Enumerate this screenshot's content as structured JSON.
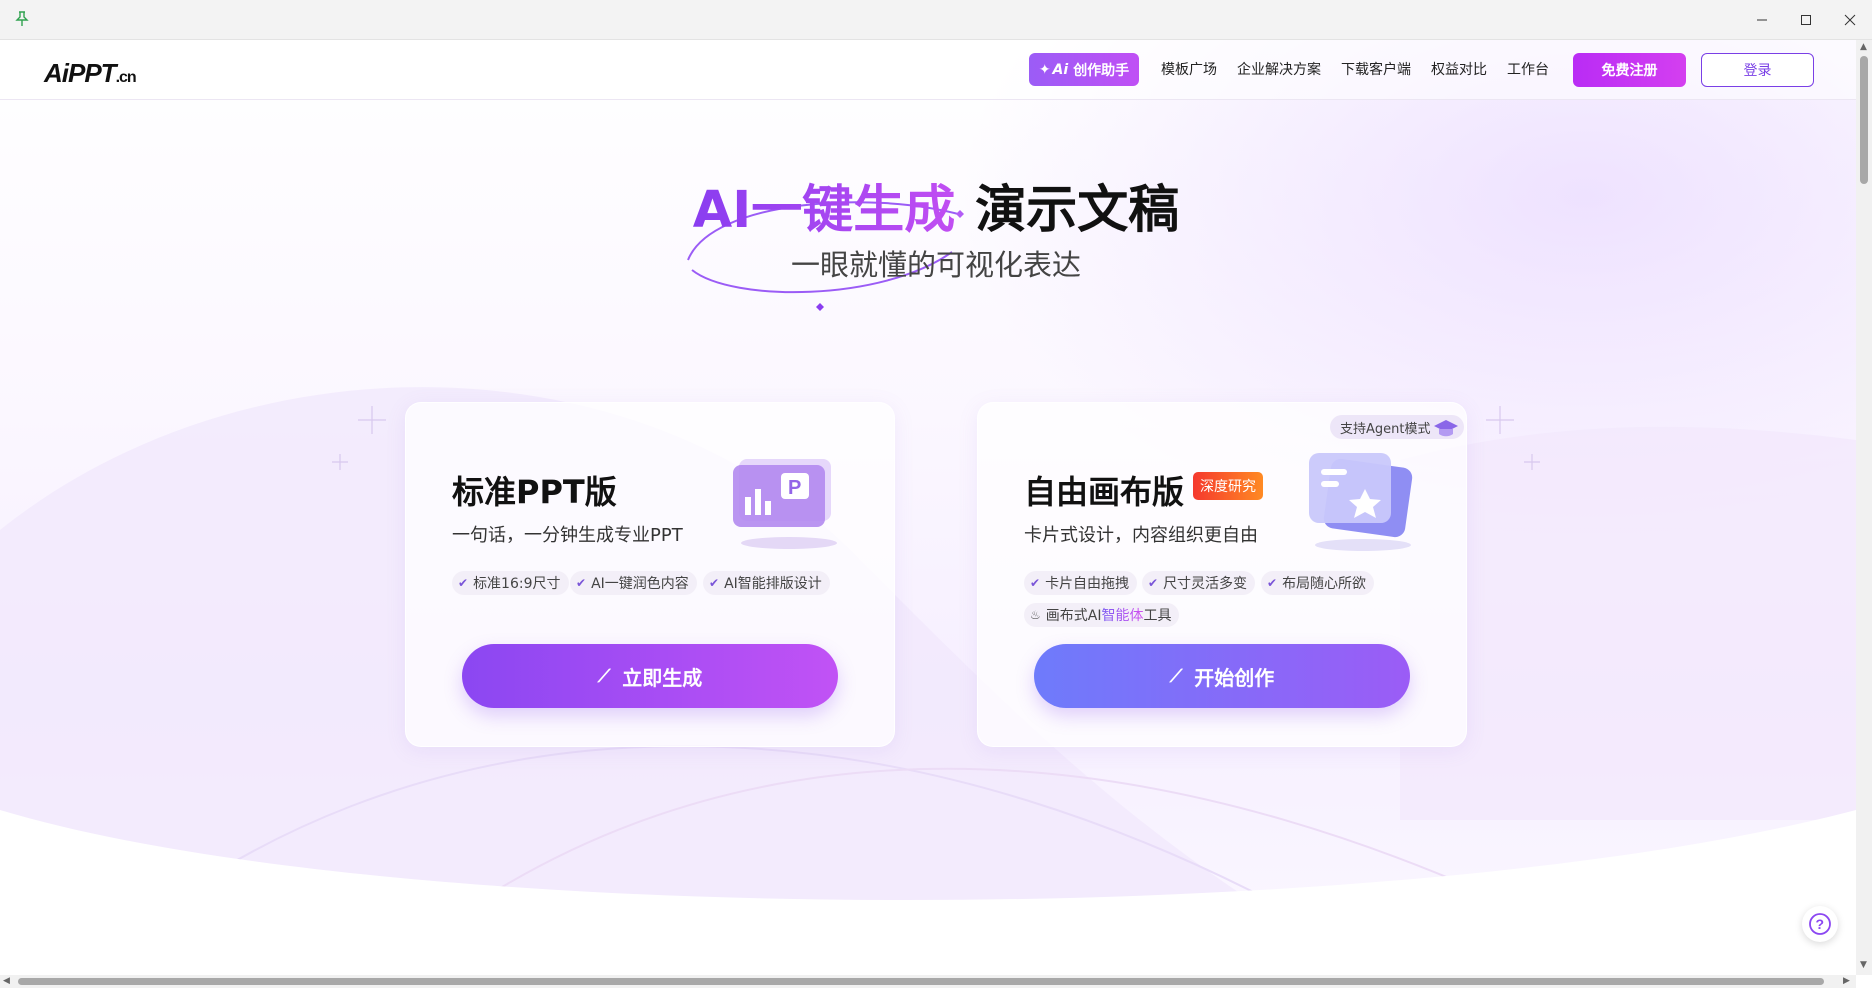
{
  "window": {
    "pin_icon": "pin-icon",
    "minimize_icon": "minimize-icon",
    "maximize_icon": "maximize-icon",
    "close_icon": "close-icon"
  },
  "logo": {
    "main": "AiPPT",
    "suffix": ".cn"
  },
  "nav": {
    "ai_assistant": "创作助手",
    "ai_prefix": "Ai",
    "links": [
      "模板广场",
      "企业解决方案",
      "下载客户端",
      "权益对比",
      "工作台"
    ],
    "register": "免费注册",
    "login": "登录"
  },
  "hero": {
    "title_highlight": "AI一键生成",
    "title_rest": "演示文稿",
    "subtitle": "一眼就懂的可视化表达"
  },
  "cards": [
    {
      "title": "标准PPT版",
      "subtitle": "一句话，一分钟生成专业PPT",
      "features": [
        "标准16:9尺寸",
        "AI一键润色内容",
        "AI智能排版设计"
      ],
      "cta": "立即生成"
    },
    {
      "title": "自由画布版",
      "badge": "深度研究",
      "agent_tag": "支持Agent模式",
      "subtitle": "卡片式设计，内容组织更自由",
      "features": [
        "卡片自由拖拽",
        "尺寸灵活多变",
        "布局随心所欲"
      ],
      "extra_feature_prefix": "画布式AI",
      "extra_feature_highlight": "智能体",
      "extra_feature_suffix": "工具",
      "cta": "开始创作"
    }
  ],
  "colors": {
    "accent": "#8b47f2",
    "brand_pink": "#c23cf3",
    "deep_badge": "#f5392e"
  }
}
